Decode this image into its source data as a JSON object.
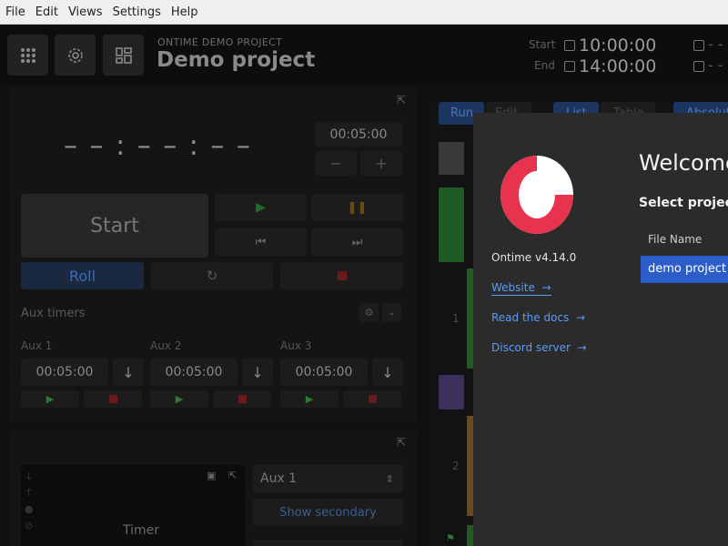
{
  "menu": [
    "File",
    "Edit",
    "Views",
    "Settings",
    "Help"
  ],
  "header": {
    "project_subtitle": "ONTIME DEMO PROJECT",
    "project_title": "Demo project",
    "start_label": "Start",
    "start_time": "10:00:00",
    "end_label": "End",
    "end_time": "14:00:00"
  },
  "timer": {
    "display": "– – : – – : – –",
    "added_time": "00:05:00",
    "minus": "−",
    "plus": "+",
    "start_label": "Start",
    "roll_label": "Roll"
  },
  "aux": {
    "section_label": "Aux timers",
    "timers": [
      {
        "label": "Aux 1",
        "value": "00:05:00"
      },
      {
        "label": "Aux 2",
        "value": "00:05:00"
      },
      {
        "label": "Aux 3",
        "value": "00:05:00"
      }
    ]
  },
  "preview": {
    "timer_label": "Timer",
    "select_value": "Aux 1",
    "secondary_button": "Show secondary"
  },
  "rundown": {
    "mode_tabs": [
      "Run",
      "Edit"
    ],
    "view_tabs": [
      "List",
      "Table"
    ],
    "absolute_label": "Absolute",
    "rows": [
      "1",
      "2"
    ]
  },
  "welcome": {
    "version": "Ontime v4.14.0",
    "title": "Welcome",
    "select_project": "Select project",
    "file_name_header": "File Name",
    "project_item": "demo project",
    "links": [
      "Website",
      "Read the docs",
      "Discord server"
    ]
  },
  "colors": {
    "accent": "#2b5ec9",
    "logo_red": "#e8334e",
    "link": "#5b9cf4"
  }
}
